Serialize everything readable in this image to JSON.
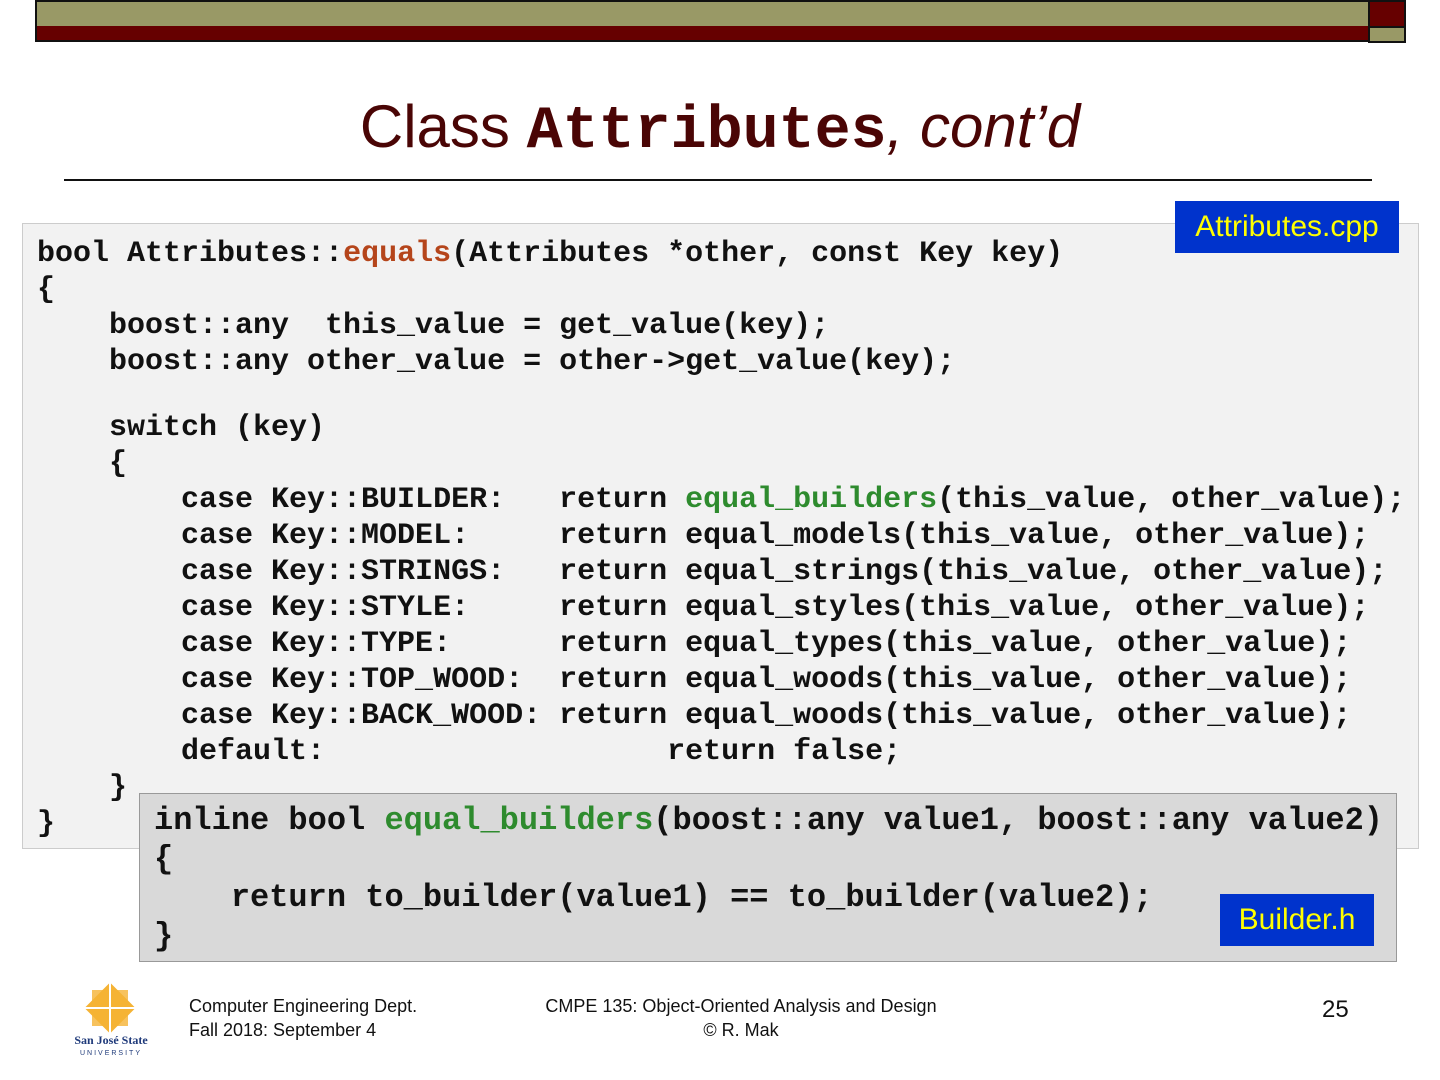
{
  "title": {
    "prefix": "Class ",
    "code": "Attributes",
    "suffix": ", cont’d"
  },
  "file_labels": {
    "cpp": "Attributes.cpp",
    "header": "Builder.h"
  },
  "colors": {
    "maroon": "#660000",
    "olive": "#999966",
    "method": "#b5451b",
    "function": "#2e8b2e",
    "label_bg": "#0033cc",
    "label_text": "#ffff00"
  },
  "code_main": [
    [
      {
        "t": "bool Attributes::"
      },
      {
        "t": "equals",
        "c": "method"
      },
      {
        "t": "(Attributes *other, const Key key)"
      }
    ],
    [
      {
        "t": "{"
      }
    ],
    [
      {
        "t": "    boost::any  this_value = get_value(key);"
      }
    ],
    [
      {
        "t": "    boost::any other_value = other->get_value(key);"
      }
    ],
    [
      {
        "t": ""
      }
    ],
    [
      {
        "t": "    switch (key)"
      }
    ],
    [
      {
        "t": "    {"
      }
    ],
    [
      {
        "t": "        case Key::BUILDER:   return "
      },
      {
        "t": "equal_builders",
        "c": "function"
      },
      {
        "t": "(this_value, other_value);"
      }
    ],
    [
      {
        "t": "        case Key::MODEL:     return equal_models(this_value, other_value);"
      }
    ],
    [
      {
        "t": "        case Key::STRINGS:   return equal_strings(this_value, other_value);"
      }
    ],
    [
      {
        "t": "        case Key::STYLE:     return equal_styles(this_value, other_value);"
      }
    ],
    [
      {
        "t": "        case Key::TYPE:      return equal_types(this_value, other_value);"
      }
    ],
    [
      {
        "t": "        case Key::TOP_WOOD:  return equal_woods(this_value, other_value);"
      }
    ],
    [
      {
        "t": "        case Key::BACK_WOOD: return equal_woods(this_value, other_value);"
      }
    ],
    [
      {
        "t": "        default:                   return false;"
      }
    ],
    [
      {
        "t": "    }"
      }
    ],
    [
      {
        "t": "}"
      }
    ]
  ],
  "code_inline": [
    [
      {
        "t": "inline bool "
      },
      {
        "t": "equal_builders",
        "c": "function"
      },
      {
        "t": "(boost::any value1, boost::any value2)"
      }
    ],
    [
      {
        "t": "{"
      }
    ],
    [
      {
        "t": "    return to_builder(value1) == to_builder(value2);"
      }
    ],
    [
      {
        "t": "}"
      }
    ]
  ],
  "footer": {
    "dept": "Computer Engineering Dept.",
    "term": "Fall 2018: September 4",
    "course": "CMPE 135: Object-Oriented Analysis and Design",
    "author": "© R. Mak",
    "page": "25",
    "logo_text": "San José State UNIVERSITY"
  }
}
